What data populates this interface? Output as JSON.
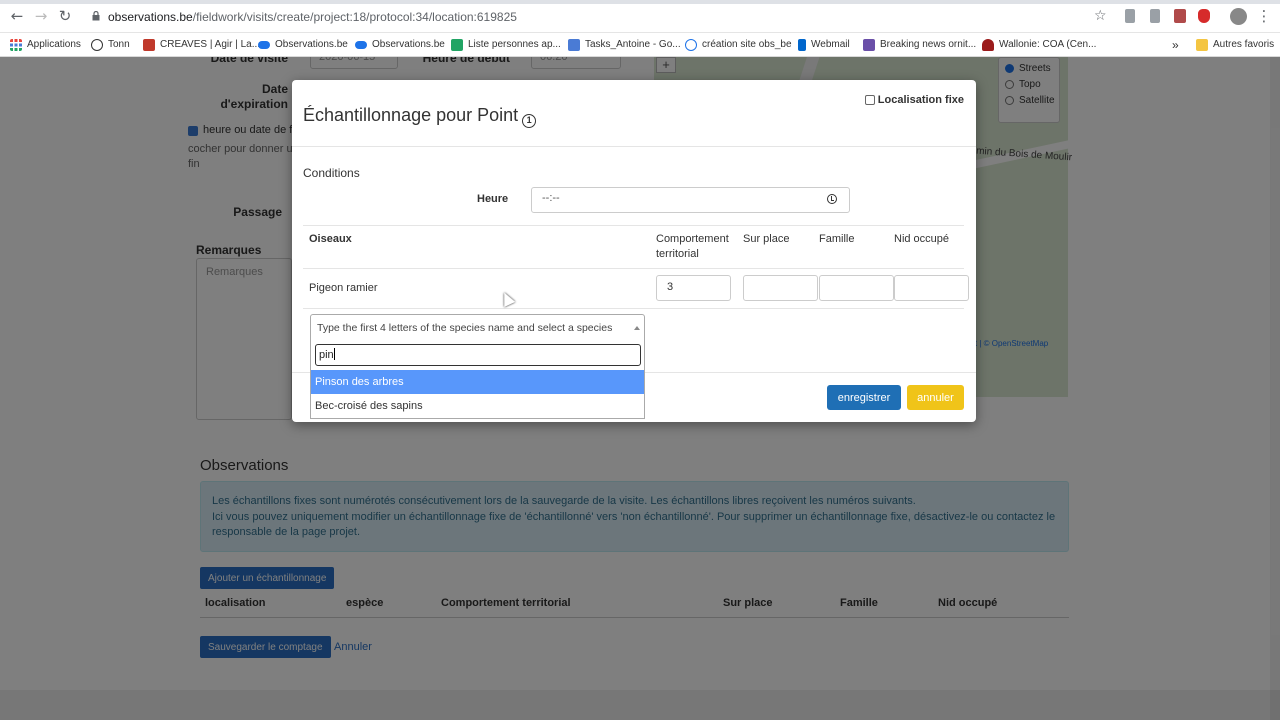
{
  "browser": {
    "url_host": "observations.be",
    "url_path": "/fieldwork/visits/create/project:18/protocol:34/location:619825",
    "bookmarks": [
      {
        "label": "Applications",
        "color": "#e8453c"
      },
      {
        "label": "Tonn",
        "color": "#333333"
      },
      {
        "label": "CREAVES | Agir | La...",
        "color": "#c0392b"
      },
      {
        "label": "Observations.be",
        "color": "#1e73e8"
      },
      {
        "label": "Observations.be",
        "color": "#1e73e8"
      },
      {
        "label": "Liste personnes ap...",
        "color": "#21a464"
      },
      {
        "label": "Tasks_Antoine - Go...",
        "color": "#4a7bd5"
      },
      {
        "label": "création site obs_be",
        "color": "#1e73e8"
      },
      {
        "label": "Webmail",
        "color": "#0066cc"
      },
      {
        "label": "Breaking news ornit...",
        "color": "#6a4fa8"
      },
      {
        "label": "Wallonie: COA (Cen...",
        "color": "#9b1b1b"
      }
    ],
    "bookmarks_more": "»",
    "other_bookmarks": "Autres favoris"
  },
  "background_form": {
    "date_visite_label": "Date de visite",
    "date_visite_value": "2020-06-15",
    "heure_debut_label": "Heure de début",
    "heure_debut_value": "06:20",
    "date_expiration_label_1": "Date",
    "date_expiration_label_2": "d'expiration",
    "checkbox_text_1": "heure ou date de f",
    "help_text_1": "cocher pour donner u",
    "help_text_2": "fin",
    "passage_label": "Passage",
    "remarques_label": "Remarques",
    "remarques_placeholder": "Remarques"
  },
  "map": {
    "zoom_in": "+",
    "layers": [
      "Streets",
      "Topo",
      "Satellite"
    ],
    "selected_layer": "Streets",
    "street_name": "min du Bois de Moulir",
    "attribution": "aflet | © OpenStreetMap"
  },
  "observations": {
    "title": "Observations",
    "info_line_1": "Les échantillons fixes sont numérotés consécutivement lors de la sauvegarde de la visite. Les échantillons libres reçoivent les numéros suivants.",
    "info_line_2": "Ici vous pouvez uniquement modifier un échantillonnage fixe de 'échantillonné' vers 'non échantillonné'. Pour supprimer un échantillonnage fixe, désactivez-le ou contactez le",
    "info_line_3": "responsable de la page projet.",
    "add_button": "Ajouter un échantillonnage",
    "columns": [
      "localisation",
      "espèce",
      "Comportement territorial",
      "Sur place",
      "Famille",
      "Nid occupé"
    ],
    "save_button": "Sauvegarder le comptage",
    "cancel_link": "Annuler"
  },
  "modal": {
    "title": "Échantillonnage pour Point",
    "info_icon": "1",
    "localisation_fixe_label": "Localisation fixe",
    "localisation_fixe_checked": false,
    "conditions_label": "Conditions",
    "heure_label": "Heure",
    "heure_value": "--:--",
    "group_header": "Oiseaux",
    "col_comportement_1": "Comportement",
    "col_comportement_2": "territorial",
    "col_sur_place": "Sur place",
    "col_famille": "Famille",
    "col_nid": "Nid occupé",
    "species_row": {
      "name": "Pigeon ramier",
      "comportement": "3",
      "sur_place": "",
      "famille": "",
      "nid": ""
    },
    "species_select_placeholder": "Type the first 4 letters of the species name and select a species",
    "search_value": "pin",
    "options": [
      "Pinson des arbres",
      "Bec-croisé des sapins"
    ],
    "highlighted_option": "Pinson des arbres",
    "save_button": "enregistrer",
    "cancel_button": "annuler"
  }
}
